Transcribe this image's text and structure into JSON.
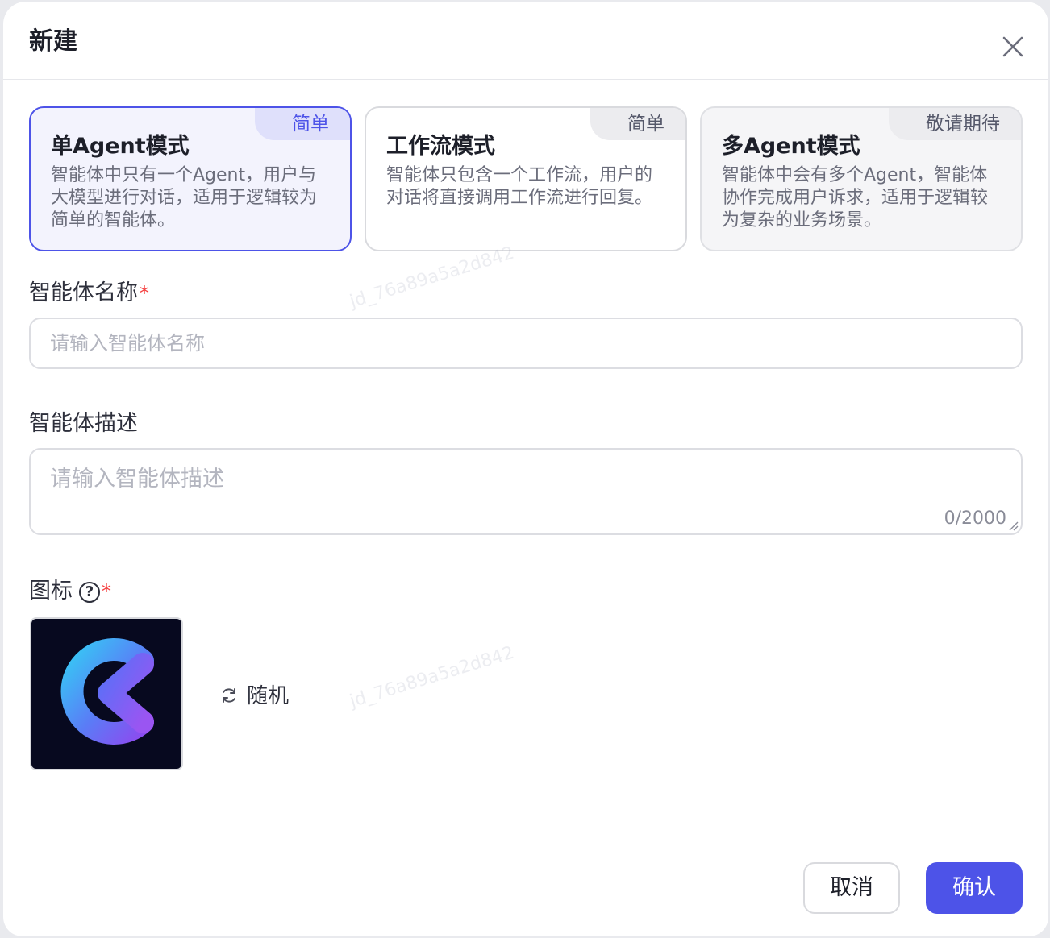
{
  "dialog": {
    "title": "新建"
  },
  "modes": [
    {
      "tag": "简单",
      "title": "单Agent模式",
      "desc": "智能体中只有一个Agent，用户与大模型进行对话，适用于逻辑较为简单的智能体。",
      "state": "selected"
    },
    {
      "tag": "简单",
      "title": "工作流模式",
      "desc": "智能体只包含一个工作流，用户的对话将直接调用工作流进行回复。",
      "state": "normal"
    },
    {
      "tag": "敬请期待",
      "title": "多Agent模式",
      "desc": "智能体中会有多个Agent，智能体协作完成用户诉求，适用于逻辑较为复杂的业务场景。",
      "state": "disabled"
    }
  ],
  "form": {
    "name_label": "智能体名称",
    "required_mark": "*",
    "name_placeholder": "请输入智能体名称",
    "desc_label": "智能体描述",
    "desc_placeholder": "请输入智能体描述",
    "desc_counter": "0/2000",
    "icon_label": "图标",
    "help_glyph": "?",
    "random_label": "随机"
  },
  "footer": {
    "cancel_label": "取消",
    "confirm_label": "确认"
  },
  "watermark": "jd_76a89a5a2d842",
  "colors": {
    "accent": "#4d53e8",
    "required": "#f53f3f",
    "icon_bg": "#07091f"
  },
  "icons": {
    "close": "close-icon",
    "help": "question-circle-icon",
    "refresh": "refresh-icon",
    "agent_logo": "agent-logo-icon"
  }
}
